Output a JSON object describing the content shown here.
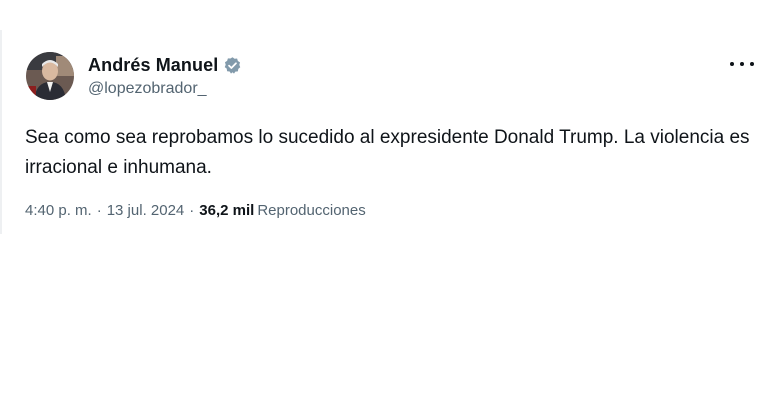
{
  "tweet": {
    "author": {
      "display_name": "Andrés Manuel",
      "handle": "@lopezobrador_",
      "verified": true,
      "verified_color": "#829aab",
      "avatar_icon": "profile-photo"
    },
    "text": "Sea como sea reprobamos lo sucedido al expresidente Donald Trump. La violencia es irracional e inhumana.",
    "time": "4:40 p. m.",
    "separator": "·",
    "date": "13 jul. 2024",
    "views_count": "36,2 mil",
    "views_label": "Reproducciones",
    "more_icon": "more-options-icon"
  }
}
